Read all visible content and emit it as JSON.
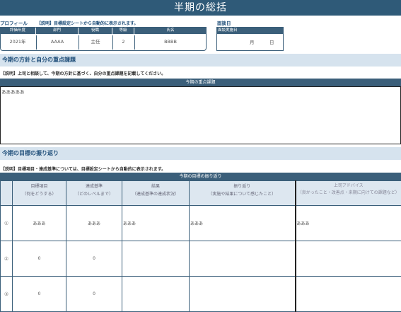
{
  "page": {
    "title": "半期の総括"
  },
  "profile": {
    "label": "プロフィール",
    "note": "【説明】目標設定シートから自動的に表示されます。",
    "headers": [
      "評価年度",
      "部門",
      "役職",
      "等級",
      "氏名"
    ],
    "values": [
      "2021年",
      "AAAA",
      "主任",
      "2",
      "BBBB"
    ]
  },
  "interview": {
    "label": "面談日",
    "header": "面談実施日",
    "month_unit": "月",
    "day_unit": "日"
  },
  "policy": {
    "section_title": "今期の方針と自分の重点課題",
    "note": "【説明】上司と相談して、今期の方針に基づく、自分の重点課題を記載してください。",
    "box_header": "今期の重点課題",
    "content": "あああああ"
  },
  "goals": {
    "section_title": "今期の目標の振り返り",
    "note": "【説明】目標項目・達成基準については、目標設定シートから自動的に表示されます。",
    "table_header": "今期の目標の振り返り",
    "columns": [
      {
        "line1": "目標項目",
        "line2": "（何をどうする）"
      },
      {
        "line1": "達成基準",
        "line2": "（どのレベルまで）"
      },
      {
        "line1": "結果",
        "line2": "（達成基準の達成状況）"
      },
      {
        "line1": "振り返り",
        "line2": "（実施や結果について感じたこと）"
      },
      {
        "line1": "上司アドバイス",
        "line2": "（良かったこと・改善点・来期に向けての課題など）"
      }
    ],
    "rows": [
      {
        "no": "①",
        "item": "あああ",
        "criteria": "あああ",
        "result": "あああ",
        "review": "あああ",
        "advice": "あああ"
      },
      {
        "no": "②",
        "item": "0",
        "criteria": "0",
        "result": "",
        "review": "",
        "advice": ""
      },
      {
        "no": "③",
        "item": "0",
        "criteria": "0",
        "result": "",
        "review": "",
        "advice": ""
      }
    ]
  }
}
